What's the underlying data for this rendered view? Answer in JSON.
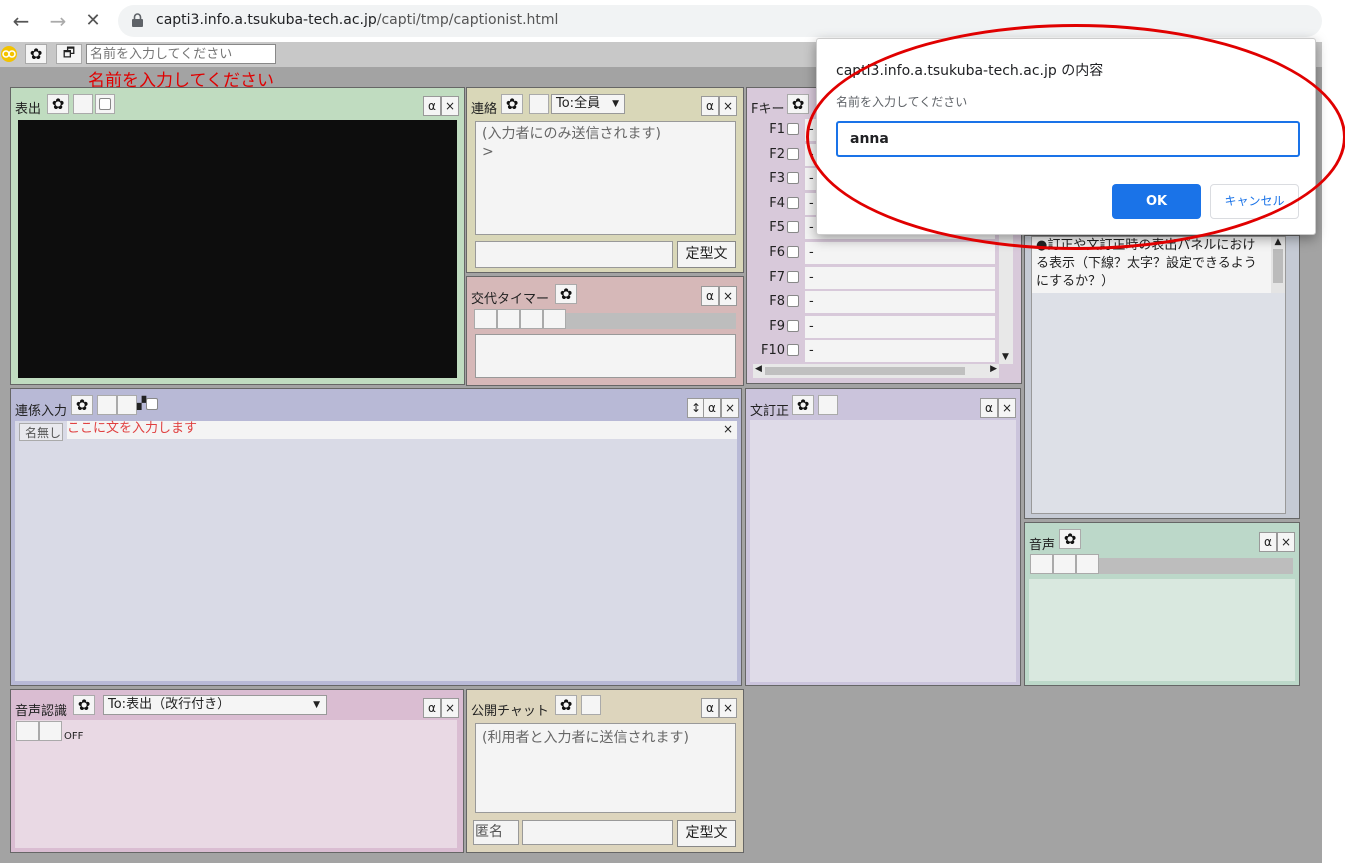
{
  "browser": {
    "url_host": "capti3.info.a.tsukuba-tech.ac.jp",
    "url_path": "/capti/tmp/captionist.html",
    "back_icon": "←",
    "forward_icon": "→",
    "stop_icon": "✕"
  },
  "toolbar": {
    "name_placeholder": "名前を入力してください",
    "name_warning": "名前を入力してください"
  },
  "panels": {
    "display": {
      "title": "表出"
    },
    "contact": {
      "title": "連絡",
      "to_select": "To:全員",
      "area_text": "(入力者にのみ送信されます)",
      "prompt": ">",
      "fixed_btn": "定型文"
    },
    "timer": {
      "title": "交代タイマー"
    },
    "fkeys": {
      "title": "Fキー",
      "keys": [
        {
          "label": "F1",
          "value": "-"
        },
        {
          "label": "F2",
          "value": "-"
        },
        {
          "label": "F3",
          "value": "-"
        },
        {
          "label": "F4",
          "value": "-"
        },
        {
          "label": "F5",
          "value": "-"
        },
        {
          "label": "F6",
          "value": "-"
        },
        {
          "label": "F7",
          "value": "-"
        },
        {
          "label": "F8",
          "value": "-"
        },
        {
          "label": "F9",
          "value": "-"
        },
        {
          "label": "F10",
          "value": "-"
        }
      ]
    },
    "notes": {
      "text": "●訂正や文訂正時の表出パネルにおける表示（下線？太字？設定できるようにするか？）"
    },
    "liaison_input": {
      "title": "連係入力",
      "name_tag": "名無し",
      "input_placeholder": "ここに文を入力します"
    },
    "sentence_fix": {
      "title": "文訂正"
    },
    "voice": {
      "title": "音声"
    },
    "speech_rec": {
      "title": "音声認識",
      "to_select": "To:表出（改行付き）",
      "status": "OFF"
    },
    "public_chat": {
      "title": "公開チャット",
      "area_text": "(利用者と入力者に送信されます)",
      "anon_label": "匿名",
      "fixed_btn": "定型文"
    }
  },
  "common": {
    "alpha": "α",
    "close": "×",
    "resize": "↕"
  },
  "dialog": {
    "title": "capti3.info.a.tsukuba-tech.ac.jp の内容",
    "message": "名前を入力してください",
    "input_value": "anna",
    "ok": "OK",
    "cancel": "キャンセル"
  },
  "colors": {
    "accent_blue": "#1a73e8",
    "annotation_red": "#e00000"
  }
}
